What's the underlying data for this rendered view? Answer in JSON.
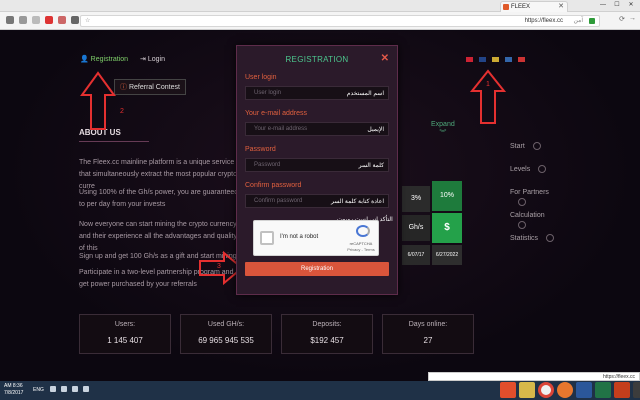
{
  "browser": {
    "tab_title": "FLEEX",
    "url": "https://fleex.cc",
    "rtl_label": "آمن",
    "minimize": "—",
    "maximize": "☐",
    "close": "✕"
  },
  "nav": {
    "registration": "Registration",
    "login": "Login",
    "referral": "Referral Contest",
    "expand": "Expand"
  },
  "about": {
    "title": "ABOUT US",
    "paragraphs": [
      "The Fleex.cc mainline platform is a unique service that simultaneously extract the most popular crypto curre",
      "Using 100% of the Gh/s power, you are guaranteed to per day from your invests",
      "Now everyone can start mining the crypto currency and their experience all the advantages and quality of this",
      "Sign up and get 100 Gh/s as a gift and start mining",
      "Participate in a two-level partnership program and get power purchased by your referrals"
    ]
  },
  "side_menu": [
    "Start",
    "Levels",
    "For Partners",
    "Calculation",
    "Statistics"
  ],
  "cubes": [
    "3%",
    "10%",
    "Gh/s",
    "$",
    "6/07/17",
    "6/27/2022"
  ],
  "stats": [
    {
      "label": "Users:",
      "value": "1 145 407"
    },
    {
      "label": "Used GH/s:",
      "value": "69 965 945 535"
    },
    {
      "label": "Deposits:",
      "value": "$192 457"
    },
    {
      "label": "Days online:",
      "value": "27"
    }
  ],
  "modal": {
    "title": "REGISTRATION",
    "close": "✕",
    "fields": [
      {
        "label": "User login",
        "placeholder": "User login",
        "rtl": "اسم المستخدم"
      },
      {
        "label": "Your e-mail address",
        "placeholder": "Your e-mail address",
        "rtl": "الإيميل"
      },
      {
        "label": "Password",
        "placeholder": "Password",
        "rtl": "كلمة السر"
      },
      {
        "label": "Confirm password",
        "placeholder": "Confirm password",
        "rtl": "اعادة كتابة كلمة السر"
      }
    ],
    "captcha_tip": "التأكد اني لست روبوت",
    "captcha_text": "I'm not a robot",
    "captcha_brand": "reCAPTCHA",
    "captcha_terms": "Privacy - Terms",
    "submit": "Registration"
  },
  "annotations": {
    "one": "1",
    "two": "2",
    "three": "3"
  },
  "taskbar": {
    "time": "AM 8:36",
    "date": "7/8/2017",
    "lang": "ENG",
    "notification": "https://fleex.cc"
  }
}
